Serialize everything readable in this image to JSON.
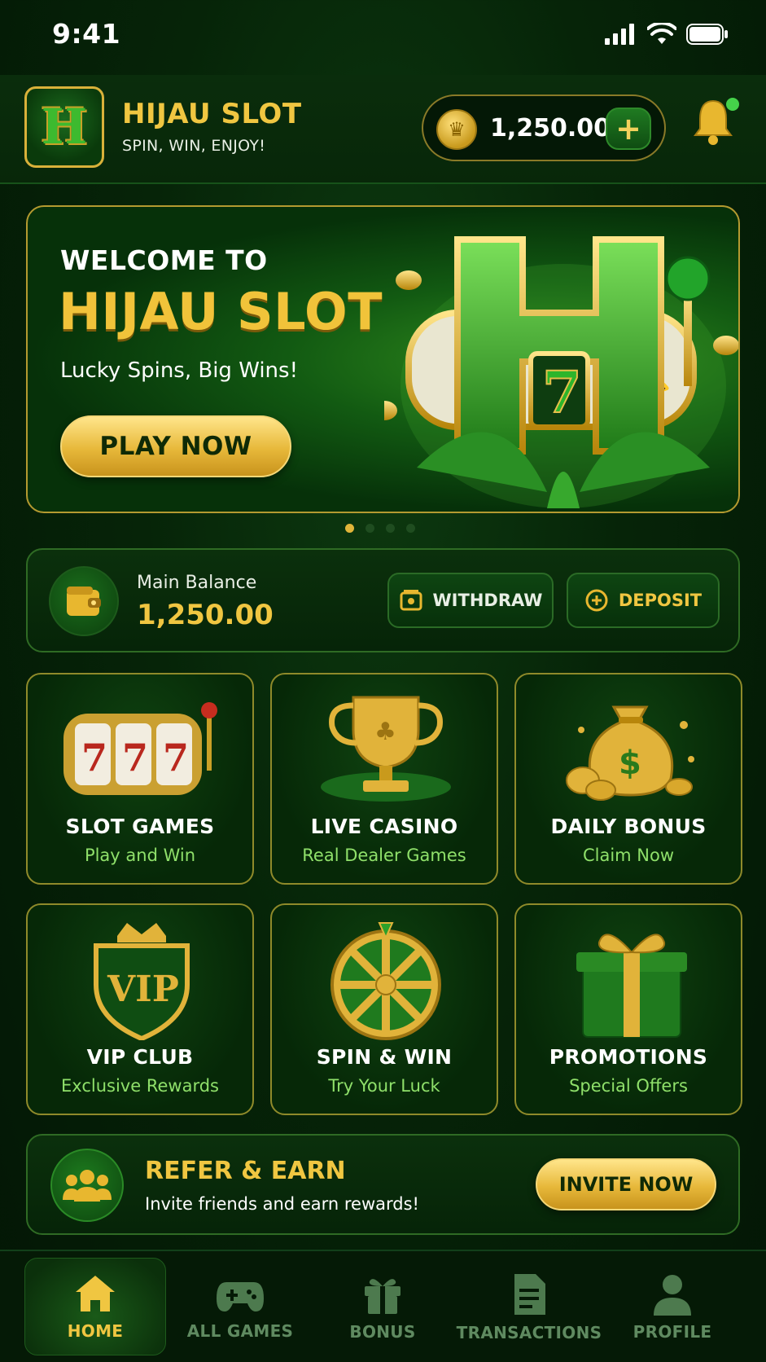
{
  "status_bar": {
    "time": "9:41"
  },
  "header": {
    "logo_letter": "H",
    "title": "HIJAU SLOT",
    "subtitle": "SPIN, WIN, ENJOY!",
    "coin_balance": "1,250.00",
    "add_label": "+"
  },
  "hero": {
    "welcome": "WELCOME TO",
    "title": "HIJAU SLOT",
    "tagline": "Lucky Spins, Big Wins!",
    "button": "PLAY NOW",
    "slides": 4,
    "active_slide": 1
  },
  "balance": {
    "label": "Main Balance",
    "value": "1,250.00",
    "withdraw": "WITHDRAW",
    "deposit": "DEPOSIT"
  },
  "tiles": [
    {
      "title": "SLOT GAMES",
      "subtitle": "Play and Win",
      "icon": "slot-machine-icon"
    },
    {
      "title": "LIVE CASINO",
      "subtitle": "Real Dealer Games",
      "icon": "trophy-icon"
    },
    {
      "title": "DAILY BONUS",
      "subtitle": "Claim Now",
      "icon": "money-bag-icon"
    },
    {
      "title": "VIP CLUB",
      "subtitle": "Exclusive Rewards",
      "icon": "vip-shield-icon"
    },
    {
      "title": "SPIN & WIN",
      "subtitle": "Try Your Luck",
      "icon": "wheel-icon"
    },
    {
      "title": "PROMOTIONS",
      "subtitle": "Special Offers",
      "icon": "gift-icon"
    }
  ],
  "refer": {
    "title": "REFER & EARN",
    "subtitle": "Invite friends and earn rewards!",
    "button": "INVITE NOW"
  },
  "nav": [
    {
      "label": "HOME",
      "active": true
    },
    {
      "label": "ALL GAMES",
      "active": false
    },
    {
      "label": "BONUS",
      "active": false
    },
    {
      "label": "TRANSACTIONS",
      "active": false
    },
    {
      "label": "PROFILE",
      "active": false
    }
  ],
  "colors": {
    "gold": "#f0c641",
    "green_accent": "#8fe06a",
    "bg": "#062408"
  }
}
